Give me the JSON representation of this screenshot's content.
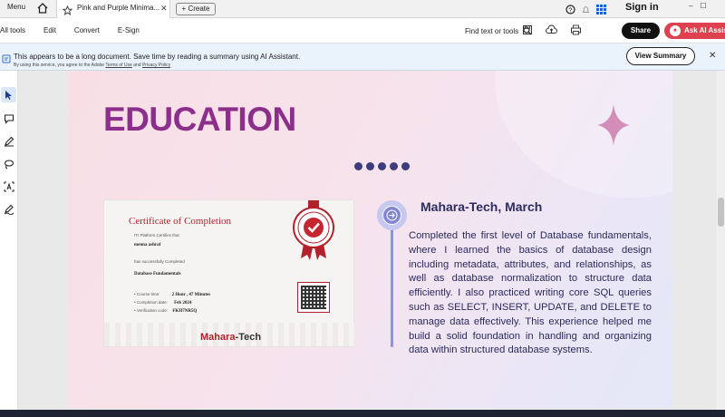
{
  "tabbar": {
    "menu_label": "Menu",
    "tab_title": "Pink and Purple Minima...",
    "create_label": "+ Create",
    "signin_label": "Sign in"
  },
  "toolbar": {
    "items": [
      "All tools",
      "Edit",
      "Convert",
      "E-Sign"
    ],
    "find_label": "Find text or tools",
    "share_label": "Share",
    "askai_label": "Ask AI Assist"
  },
  "banner": {
    "message": "This appears to be a long document. Save time by reading a summary using AI Assistant.",
    "legal_prefix": "By using this service, you agree to the Adobe",
    "terms_link": "Terms of Use",
    "legal_and": "and",
    "privacy_link": "Privacy Policy",
    "view_summary_label": "View Summary"
  },
  "document": {
    "heading": "EDUCATION",
    "certificate": {
      "title": "Certificate of Completion",
      "certifies": "ITI Platform Certifies that",
      "name": "menna ashraf",
      "completed": "has successfully Completed",
      "course": "Database Fundamentals",
      "course_time_label": "• Course time:",
      "course_time_value": "2 Hour , 47 Minutes",
      "completion_date_label": "• Completion date:",
      "completion_date_value": "Feb 2024",
      "verification_label": "• Verification code:",
      "verification_value": "FKH7NR5Q",
      "logo_a": "Mahara",
      "logo_b": "-Tech"
    },
    "entry_title": "Mahara-Tech, March",
    "entry_description": "Completed the first level of Database fundamentals, where I learned the basics of database design including metadata, attributes, and relationships, as well as database normalization to structure data efficiently. I also practiced writing core SQL queries such as SELECT, INSERT, UPDATE, and DELETE to manage data effectively. This experience helped me build a solid foundation in handling and organizing data within structured database systems."
  },
  "colors": {
    "heading": "#8b2f8a",
    "accent_red": "#e0414e",
    "timeline": "#8185d6",
    "text": "#2b2a5e"
  }
}
